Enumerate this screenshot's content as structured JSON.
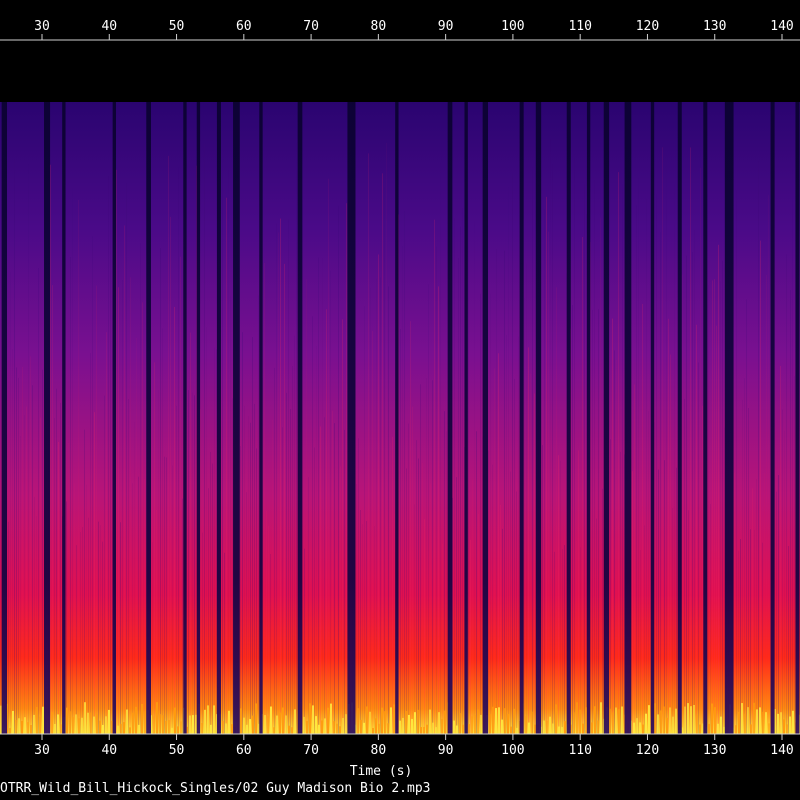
{
  "chart_data": {
    "type": "heatmap",
    "kind": "spectrogram",
    "title": "",
    "xlabel": "Time (s)",
    "ylabel": "",
    "x_ticks": [
      30,
      40,
      50,
      60,
      70,
      80,
      90,
      100,
      110,
      120,
      130,
      140
    ],
    "xlim": [
      24,
      144
    ],
    "colormap": [
      "#000000",
      "#1a0060",
      "#4a0a9a",
      "#a0109a",
      "#e01050",
      "#ff3010",
      "#ff9000",
      "#ffee40"
    ],
    "quiet_segments_s": [
      [
        24.0,
        24.8
      ],
      [
        30.3,
        31.2
      ],
      [
        33.0,
        33.5
      ],
      [
        40.5,
        41.0
      ],
      [
        45.5,
        46.2
      ],
      [
        51.0,
        51.5
      ],
      [
        53.0,
        53.5
      ],
      [
        56.0,
        56.6
      ],
      [
        58.4,
        59.4
      ],
      [
        62.3,
        62.8
      ],
      [
        68.0,
        68.7
      ],
      [
        75.4,
        76.6
      ],
      [
        82.5,
        83.0
      ],
      [
        90.3,
        91.0
      ],
      [
        92.8,
        93.3
      ],
      [
        95.5,
        96.3
      ],
      [
        101.0,
        101.6
      ],
      [
        103.4,
        104.2
      ],
      [
        108.0,
        108.6
      ],
      [
        111.0,
        111.5
      ],
      [
        113.5,
        114.3
      ],
      [
        116.6,
        117.6
      ],
      [
        120.5,
        121.0
      ],
      [
        124.5,
        125.1
      ],
      [
        128.3,
        128.9
      ],
      [
        131.5,
        132.8
      ],
      [
        138.3,
        138.9
      ],
      [
        142.0,
        142.6
      ]
    ]
  },
  "footer": {
    "file_name": "OTRR_Wild_Bill_Hickock_Singles/02 Guy Madison Bio 2.mp3"
  }
}
